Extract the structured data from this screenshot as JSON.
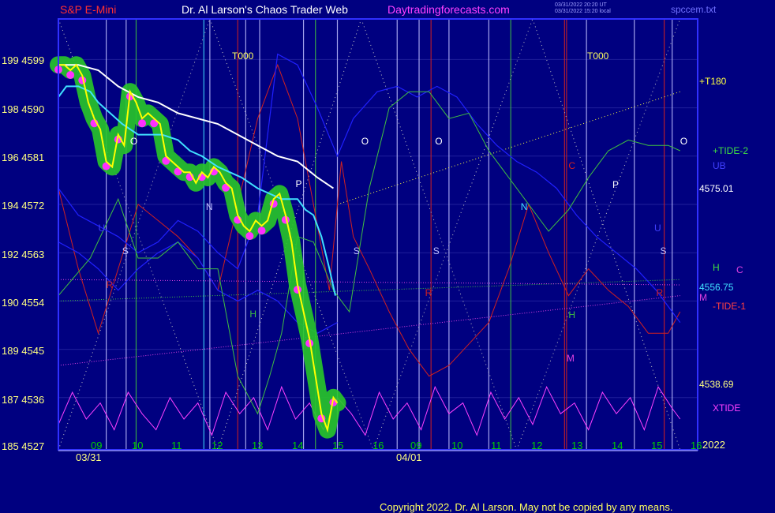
{
  "header": {
    "symbol": "S&P E-Mini",
    "title": "Dr. Al Larson's Chaos Trader Web",
    "site": "Daytradingforecasts.com",
    "stamp1": "03/31/2022 20:20 UT",
    "stamp2": "03/31/2022 15:20 local",
    "file": "spccem.txt"
  },
  "footer": {
    "copyright": "Copyright 2022, Dr. Al Larson. May not be copied by any means."
  },
  "colors": {
    "background": "#000080",
    "price": "#ffff00",
    "price_band": "#28c828",
    "moving_avg_slow": "#ffffff",
    "moving_avg_fast": "#40e0ff",
    "tide2": "#40c040",
    "tide1": "#e040e0",
    "xtide": "#ff40ff",
    "red_cycle": "#d02020",
    "axis_frame": "#3030ff"
  },
  "chart_data": {
    "type": "line",
    "title": "S&P E-Mini",
    "y_left_ticks": [
      "199 4599",
      "198 4590",
      "196 4581",
      "194 4572",
      "192 4563",
      "190 4554",
      "189 4545",
      "187 4536",
      "185 4527"
    ],
    "ylim": [
      4527,
      4603
    ],
    "x_hour_ticks": [
      "09",
      "10",
      "11",
      "12",
      "13",
      "14",
      "15",
      "16",
      "09",
      "10",
      "11",
      "12",
      "13",
      "14",
      "15",
      "16"
    ],
    "x_date_labels": [
      "03/31",
      "04/01"
    ],
    "year_label": "2022",
    "top_markers": [
      "T000",
      "T000"
    ],
    "right_labels": {
      "t180": "+T180",
      "tide2": "+TIDE-2",
      "ub": "UB",
      "level1": "4575.01",
      "h": "H",
      "c": "C",
      "level2": "4556.75",
      "m": "M",
      "tide1": "-TIDE-1",
      "level3": "4538.69",
      "xtide": "XTIDE"
    },
    "levels": [
      4575.01,
      4556.75,
      4538.69
    ],
    "series": [
      {
        "name": "price",
        "x": [
          0,
          0.15,
          0.3,
          0.45,
          0.6,
          0.75,
          0.9,
          1.05,
          1.2,
          1.35,
          1.5,
          1.65,
          1.8,
          1.95,
          2.1,
          2.25,
          2.4,
          2.55,
          2.7,
          2.85,
          3.0,
          3.15,
          3.3,
          3.45,
          3.6,
          3.75,
          3.9,
          4.05,
          4.2,
          4.35,
          4.5,
          4.65,
          4.8,
          4.95,
          5.1,
          5.25,
          5.4,
          5.55,
          5.7,
          5.85,
          6.0,
          6.15,
          6.3,
          6.45,
          6.6,
          6.75,
          6.9,
          7.0
        ],
        "values": [
          4598,
          4598,
          4597,
          4598,
          4596,
          4591,
          4588,
          4586,
          4580,
          4579,
          4585,
          4583,
          4593,
          4591,
          4588,
          4589,
          4588,
          4587,
          4581,
          4580,
          4579,
          4578,
          4578,
          4576,
          4578,
          4577,
          4579,
          4578,
          4576,
          4575,
          4570,
          4568,
          4567,
          4569,
          4568,
          4569,
          4573,
          4574,
          4570,
          4565,
          4557,
          4552,
          4547,
          4540,
          4533,
          4530,
          4536,
          4535
        ]
      },
      {
        "name": "slow-average",
        "x": [
          0,
          0.5,
          1,
          1.5,
          2,
          2.5,
          3,
          3.5,
          4,
          4.5,
          5,
          5.5,
          6,
          6.5,
          6.9
        ],
        "values": [
          4598,
          4598,
          4597,
          4594,
          4592,
          4591,
          4589,
          4588,
          4587,
          4585,
          4583,
          4581,
          4580,
          4577,
          4575
        ]
      },
      {
        "name": "fast-average",
        "x": [
          0,
          0.2,
          0.5,
          0.8,
          1,
          1.3,
          1.6,
          2,
          2.3,
          2.6,
          3,
          3.3,
          3.6,
          4,
          4.3,
          4.6,
          5,
          5.3,
          5.6,
          6,
          6.2,
          6.4,
          6.6,
          6.8,
          6.95
        ],
        "values": [
          4592,
          4594,
          4594,
          4593,
          4591,
          4589,
          4587,
          4585,
          4585,
          4585,
          4584,
          4582,
          4581,
          4579,
          4578,
          4577,
          4575,
          4574,
          4573,
          4573,
          4571,
          4570,
          4566,
          4560,
          4555
        ]
      },
      {
        "name": "tide2",
        "x": [
          0,
          0.8,
          1.5,
          2,
          2.5,
          3,
          3.5,
          4,
          4.5,
          5,
          5.3,
          5.6,
          6,
          6.4,
          6.9,
          7.3,
          7.8,
          8.3,
          8.8,
          9.3,
          9.8,
          10.3,
          10.8,
          11.3,
          11.8,
          12.3,
          12.8,
          13.3,
          13.8,
          14.3,
          14.8,
          15.3,
          15.6
        ],
        "values": [
          4555,
          4562,
          4573,
          4562,
          4562,
          4565,
          4560,
          4560,
          4540,
          4533,
          4540,
          4548,
          4566,
          4565,
          4556,
          4552,
          4575,
          4590,
          4593,
          4593,
          4588,
          4589,
          4582,
          4577,
          4572,
          4567,
          4571,
          4577,
          4582,
          4584,
          4583,
          4583,
          4582
        ]
      },
      {
        "name": "red-cycle",
        "x": [
          0,
          0.5,
          1,
          1.5,
          2,
          2.5,
          3,
          3.5,
          4,
          4.5,
          5,
          5.5,
          6,
          6.4,
          6.8,
          7.1,
          7.4,
          7.8,
          8.3,
          8.8,
          9.3,
          9.8,
          10.3,
          10.8,
          11.3,
          11.8,
          12.3,
          12.8,
          13.3,
          13.8,
          14.3,
          14.8,
          15.3,
          15.6
        ],
        "values": [
          4575,
          4560,
          4548,
          4560,
          4572,
          4569,
          4566,
          4562,
          4556,
          4572,
          4588,
          4598,
          4588,
          4572,
          4556,
          4580,
          4566,
          4560,
          4552,
          4545,
          4540,
          4542,
          4546,
          4550,
          4560,
          4572,
          4563,
          4555,
          4560,
          4556,
          4553,
          4548,
          4548,
          4552
        ]
      },
      {
        "name": "blue-cycle",
        "x": [
          0,
          0.5,
          1,
          1.5,
          2,
          2.5,
          3,
          3.5,
          4,
          4.5,
          5,
          5.5,
          6,
          6.5,
          7,
          7.4,
          8,
          8.5,
          9,
          9.5,
          10,
          10.5,
          11,
          11.5,
          12,
          12.5,
          13,
          13.5,
          14,
          14.5,
          15,
          15.6
        ],
        "values": [
          4575,
          4570,
          4568,
          4566,
          4563,
          4565,
          4569,
          4567,
          4563,
          4560,
          4570,
          4600,
          4598,
          4590,
          4581,
          4588,
          4593,
          4594,
          4592,
          4594,
          4592,
          4587,
          4583,
          4580,
          4578,
          4575,
          4570,
          4566,
          4563,
          4560,
          4556,
          4550
        ]
      },
      {
        "name": "blue-cycle-lower",
        "x": [
          0,
          0.5,
          1,
          1.5,
          2,
          2.5,
          3,
          3.5,
          4,
          4.5,
          5,
          5.5,
          6,
          6.5,
          7
        ],
        "values": [
          4565,
          4563,
          4560,
          4556,
          4560,
          4563,
          4565,
          4562,
          4556,
          4554,
          4556,
          4554,
          4550,
          4548,
          4550
        ]
      },
      {
        "name": "xtide",
        "x": [
          0,
          0.35,
          0.7,
          1.05,
          1.4,
          1.75,
          2.1,
          2.45,
          2.8,
          3.15,
          3.5,
          3.85,
          4.2,
          4.55,
          4.9,
          5.25,
          5.6,
          5.95,
          6.3,
          6.65,
          7,
          7.35,
          7.7,
          8.05,
          8.4,
          8.75,
          9.1,
          9.45,
          9.8,
          10.15,
          10.5,
          10.85,
          11.2,
          11.55,
          11.9,
          12.25,
          12.6,
          12.95,
          13.3,
          13.65,
          14,
          14.35,
          14.7,
          15.05,
          15.4,
          15.6
        ],
        "values": [
          4531,
          4537,
          4532,
          4535,
          4530,
          4537,
          4533,
          4530,
          4536,
          4532,
          4535,
          4529,
          4537,
          4533,
          4536,
          4530,
          4538,
          4532,
          4535,
          4530,
          4536,
          4533,
          4529,
          4537,
          4532,
          4535,
          4530,
          4538,
          4533,
          4535,
          4529,
          4537,
          4532,
          4536,
          4531,
          4538,
          4533,
          4535,
          4530,
          4537,
          4533,
          4536,
          4530,
          4538,
          4534,
          4532
        ]
      },
      {
        "name": "tide1",
        "x": [
          0,
          15.6
        ],
        "values": [
          4542,
          4555
        ]
      },
      {
        "name": "h-line",
        "x": [
          0,
          15.6
        ],
        "values": [
          4554,
          4558
        ]
      },
      {
        "name": "c-line",
        "x": [
          0,
          15.6
        ],
        "values": [
          4558,
          4557
        ]
      },
      {
        "name": "t180",
        "x": [
          7.0,
          15.6
        ],
        "values": [
          4572,
          4593
        ]
      }
    ]
  }
}
